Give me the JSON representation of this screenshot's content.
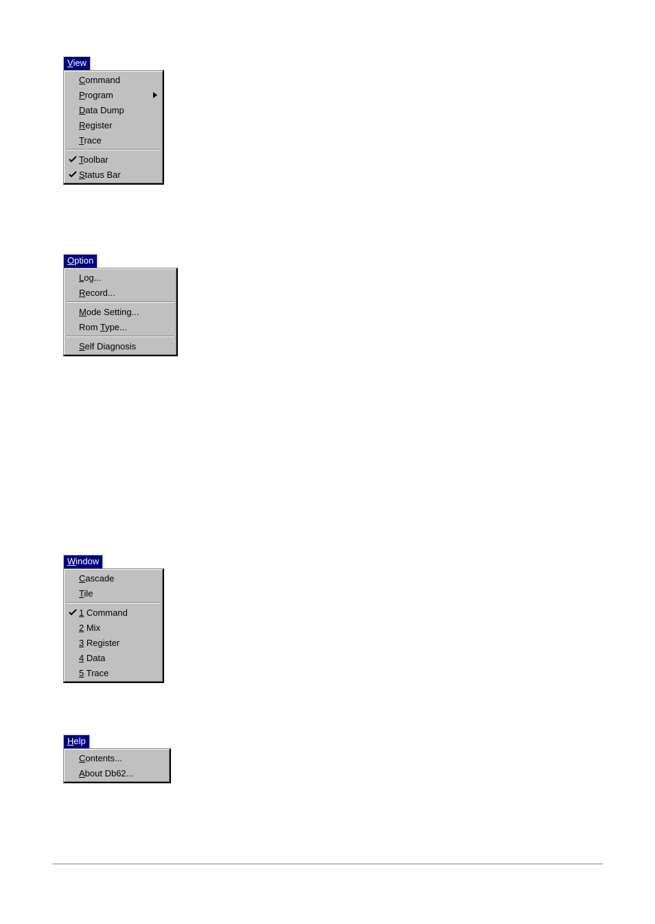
{
  "view": {
    "title_pre": "V",
    "title_rest": "iew",
    "items_a": [
      {
        "ul": "C",
        "rest": "ommand",
        "checked": false,
        "submenu": false
      },
      {
        "ul": "P",
        "rest": "rogram",
        "checked": false,
        "submenu": true
      },
      {
        "ul": "D",
        "rest": "ata Dump",
        "checked": false,
        "submenu": false
      },
      {
        "ul": "R",
        "rest": "egister",
        "checked": false,
        "submenu": false
      },
      {
        "ul": "T",
        "rest": "race",
        "checked": false,
        "submenu": false
      }
    ],
    "items_b": [
      {
        "ul": "T",
        "rest": "oolbar",
        "checked": true,
        "submenu": false
      },
      {
        "ul": "S",
        "rest": "tatus Bar",
        "checked": true,
        "submenu": false
      }
    ]
  },
  "option": {
    "title_pre": "O",
    "title_rest": "ption",
    "group1": [
      {
        "ul": "L",
        "rest": "og...",
        "checked": false
      },
      {
        "ul": "R",
        "rest": "ecord...",
        "checked": false
      }
    ],
    "group2": [
      {
        "pre": "",
        "ul": "M",
        "rest": "ode Setting...",
        "checked": false
      },
      {
        "pre": "Rom ",
        "ul": "T",
        "rest": "ype...",
        "checked": false
      }
    ],
    "group3": [
      {
        "ul": "S",
        "rest": "elf Diagnosis",
        "checked": false
      }
    ]
  },
  "window": {
    "title_pre": "W",
    "title_rest": "indow",
    "group1": [
      {
        "ul": "C",
        "rest": "ascade",
        "checked": false
      },
      {
        "ul": "T",
        "rest": "ile",
        "checked": false
      }
    ],
    "group2": [
      {
        "ul": "1",
        "rest": " Command",
        "checked": true
      },
      {
        "ul": "2",
        "rest": " Mix",
        "checked": false
      },
      {
        "ul": "3",
        "rest": " Register",
        "checked": false
      },
      {
        "ul": "4",
        "rest": " Data",
        "checked": false
      },
      {
        "ul": "5",
        "rest": " Trace",
        "checked": false
      }
    ]
  },
  "help": {
    "title_pre": "H",
    "title_rest": "elp",
    "items": [
      {
        "ul": "C",
        "rest": "ontents...",
        "checked": false
      },
      {
        "ul": "A",
        "rest": "bout Db62...",
        "checked": false
      }
    ]
  }
}
